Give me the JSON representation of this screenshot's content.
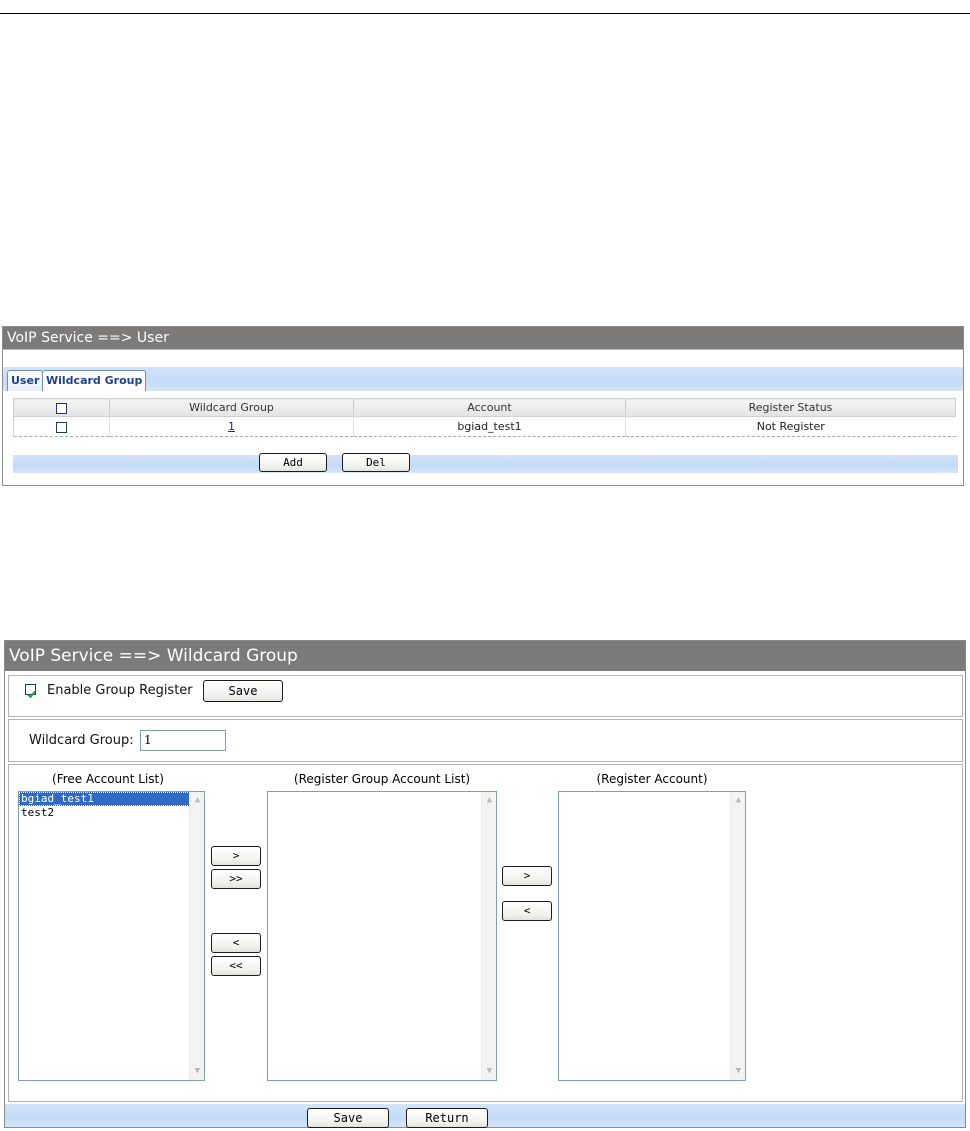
{
  "panel_user": {
    "title": "VoIP Service ==> User",
    "tabs": [
      "User",
      "Wildcard Group"
    ],
    "active_tab": "Wildcard Group",
    "table": {
      "headers": [
        "",
        "Wildcard Group",
        "Account",
        "Register Status"
      ],
      "rows": [
        {
          "group": "1",
          "account": "bgiad_test1",
          "status": "Not Register"
        }
      ]
    },
    "buttons": {
      "add": "Add",
      "del": "Del"
    }
  },
  "panel_wildcard": {
    "title": "VoIP Service ==> Wildcard Group",
    "enable_label": "Enable Group Register",
    "enable_checked": true,
    "save_label": "Save",
    "group_label": "Wildcard Group:",
    "group_value": "1",
    "lists": {
      "free_title": "(Free Account List)",
      "free_items": [
        "bgiad_test1",
        "test2"
      ],
      "free_selected": "bgiad_test1",
      "group_title": "(Register Group Account List)",
      "group_items": [],
      "register_title": "(Register Account)",
      "register_items": []
    },
    "move": {
      "right_one": ">",
      "right_all": ">>",
      "left_one": "<",
      "left_all": "<<",
      "reg_right": ">",
      "reg_left": "<"
    },
    "footer": {
      "save": "Save",
      "return": "Return"
    }
  },
  "colors": {
    "title_bar": "#7d7a7a",
    "blue_bar": "#c4daf6",
    "selection": "#316ac5",
    "link": "#1a2a8a"
  }
}
